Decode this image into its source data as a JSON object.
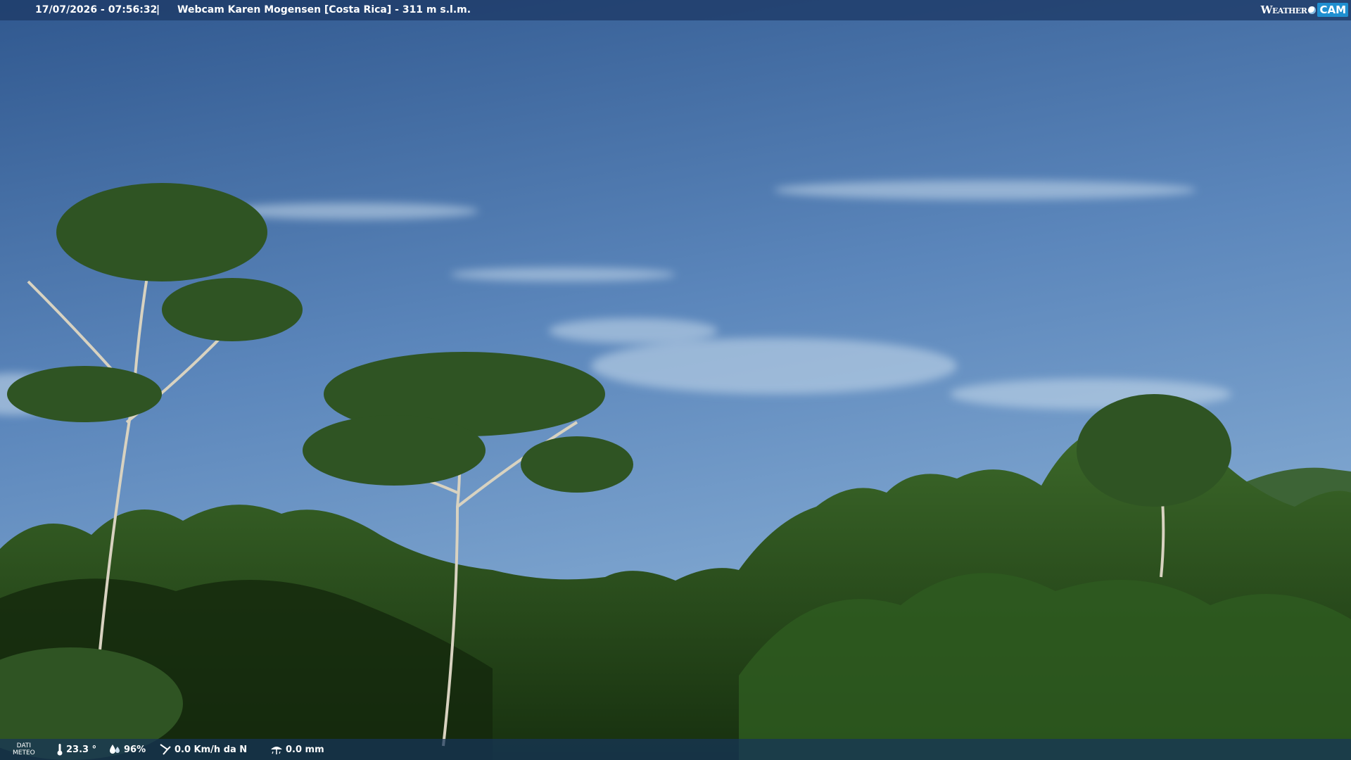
{
  "header": {
    "timestamp": "17/07/2026 - 07:56:32",
    "separator": "|",
    "title": "Webcam Karen Mogensen [Costa Rica] - 311 m s.l.m."
  },
  "logo": {
    "weather": "Weather",
    "cam": "CAM"
  },
  "weather_bar": {
    "label_line1": "DATI",
    "label_line2": "METEO",
    "temperature": "23.3 °",
    "humidity": "96%",
    "wind": "0.0 Km/h da N",
    "rain": "0.0 mm"
  },
  "icons": [
    "thermometer-icon",
    "humidity-icon",
    "wind-icon",
    "rain-icon"
  ],
  "colors": {
    "sky_top": "#30588f",
    "sky_bottom": "#7ea6cf",
    "forest": "#22481c",
    "bar": "#1e3c69"
  }
}
